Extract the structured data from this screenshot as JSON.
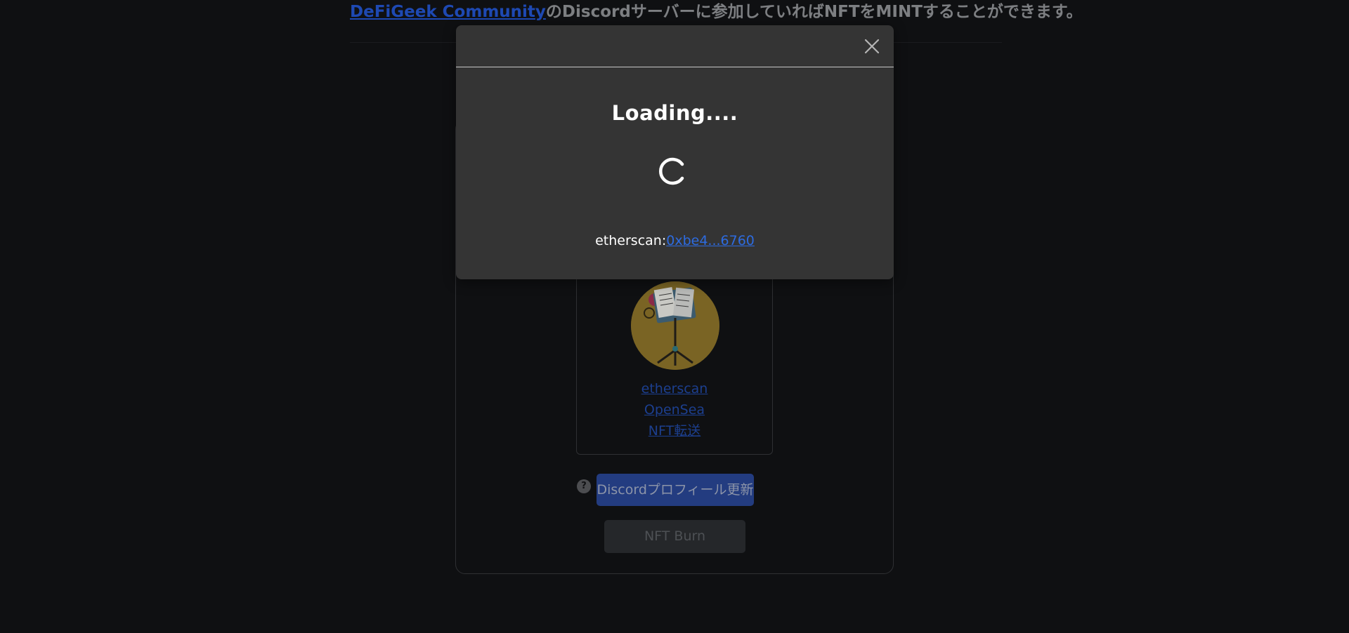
{
  "intro": {
    "link_text": "DeFiGeek Community",
    "suffix_text": "のDiscordサーバーに参加していればNFTをMINTすることができます。"
  },
  "nft_card": {
    "avatar_icon": "music-stand-nft-image",
    "links": [
      "etherscan",
      "OpenSea",
      "NFT転送"
    ]
  },
  "actions": {
    "help_icon_glyph": "?",
    "discord_button_label": "Discordプロフィール更新",
    "burn_button_label": "NFT Burn"
  },
  "modal": {
    "close_icon": "close-icon",
    "title": "Loading....",
    "etherscan_prefix": "etherscan:",
    "tx_link_text": "0xbe4...6760"
  },
  "colors": {
    "background": "#0f1012",
    "modal_background": "#343434",
    "link_blue": "#2d6be0",
    "discord_button": "#233c80"
  }
}
